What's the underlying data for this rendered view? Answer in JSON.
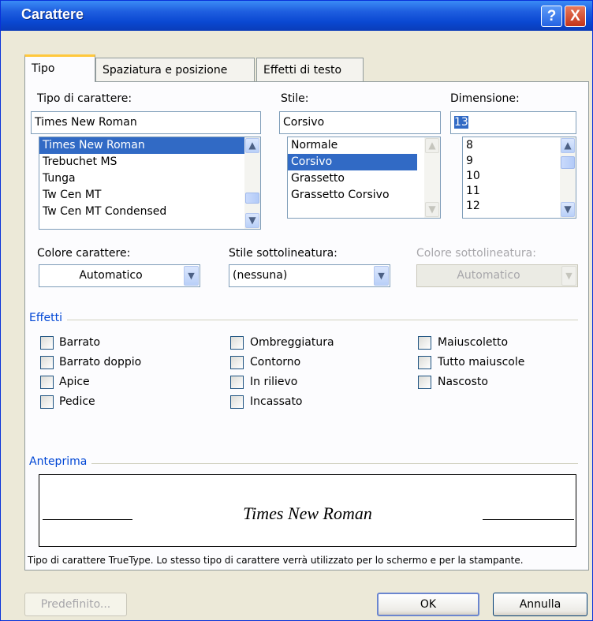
{
  "window": {
    "title": "Carattere"
  },
  "tabs": [
    {
      "label": "Tipo",
      "active": true
    },
    {
      "label": "Spaziatura e posizione",
      "active": false
    },
    {
      "label": "Effetti di testo",
      "active": false
    }
  ],
  "font": {
    "label": "Tipo di carattere:",
    "value": "Times New Roman",
    "items": [
      "Times New Roman",
      "Trebuchet MS",
      "Tunga",
      "Tw Cen MT",
      "Tw Cen MT Condensed"
    ],
    "selected_index": 0
  },
  "style": {
    "label": "Stile:",
    "value": "Corsivo",
    "items": [
      "Normale",
      "Corsivo",
      "Grassetto",
      "Grassetto Corsivo"
    ],
    "selected_index": 1
  },
  "size": {
    "label": "Dimensione:",
    "value": "13",
    "items": [
      "8",
      "9",
      "10",
      "11",
      "12"
    ]
  },
  "font_color": {
    "label": "Colore carattere:",
    "value": "Automatico"
  },
  "underline_style": {
    "label": "Stile sottolineatura:",
    "value": "(nessuna)"
  },
  "underline_color": {
    "label": "Colore sottolineatura:",
    "value": "Automatico",
    "disabled": true
  },
  "effects": {
    "title": "Effetti",
    "items": [
      {
        "label": "Barrato",
        "checked": false
      },
      {
        "label": "Barrato doppio",
        "checked": false
      },
      {
        "label": "Apice",
        "checked": false
      },
      {
        "label": "Pedice",
        "checked": false
      },
      {
        "label": "Ombreggiatura",
        "checked": false
      },
      {
        "label": "Contorno",
        "checked": false
      },
      {
        "label": "In rilievo",
        "checked": false
      },
      {
        "label": "Incassato",
        "checked": false
      },
      {
        "label": "Maiuscoletto",
        "checked": false
      },
      {
        "label": "Tutto maiuscole",
        "checked": false
      },
      {
        "label": "Nascosto",
        "checked": false
      }
    ]
  },
  "preview": {
    "title": "Anteprima",
    "sample": "Times New Roman",
    "info": "Tipo di carattere TrueType. Lo stesso tipo di carattere verrà utilizzato per lo schermo e per la stampante."
  },
  "buttons": {
    "default": "Predefinito...",
    "ok": "OK",
    "cancel": "Annulla"
  },
  "icons": {
    "help": "?",
    "close": "X",
    "up": "▲",
    "down": "▼"
  }
}
